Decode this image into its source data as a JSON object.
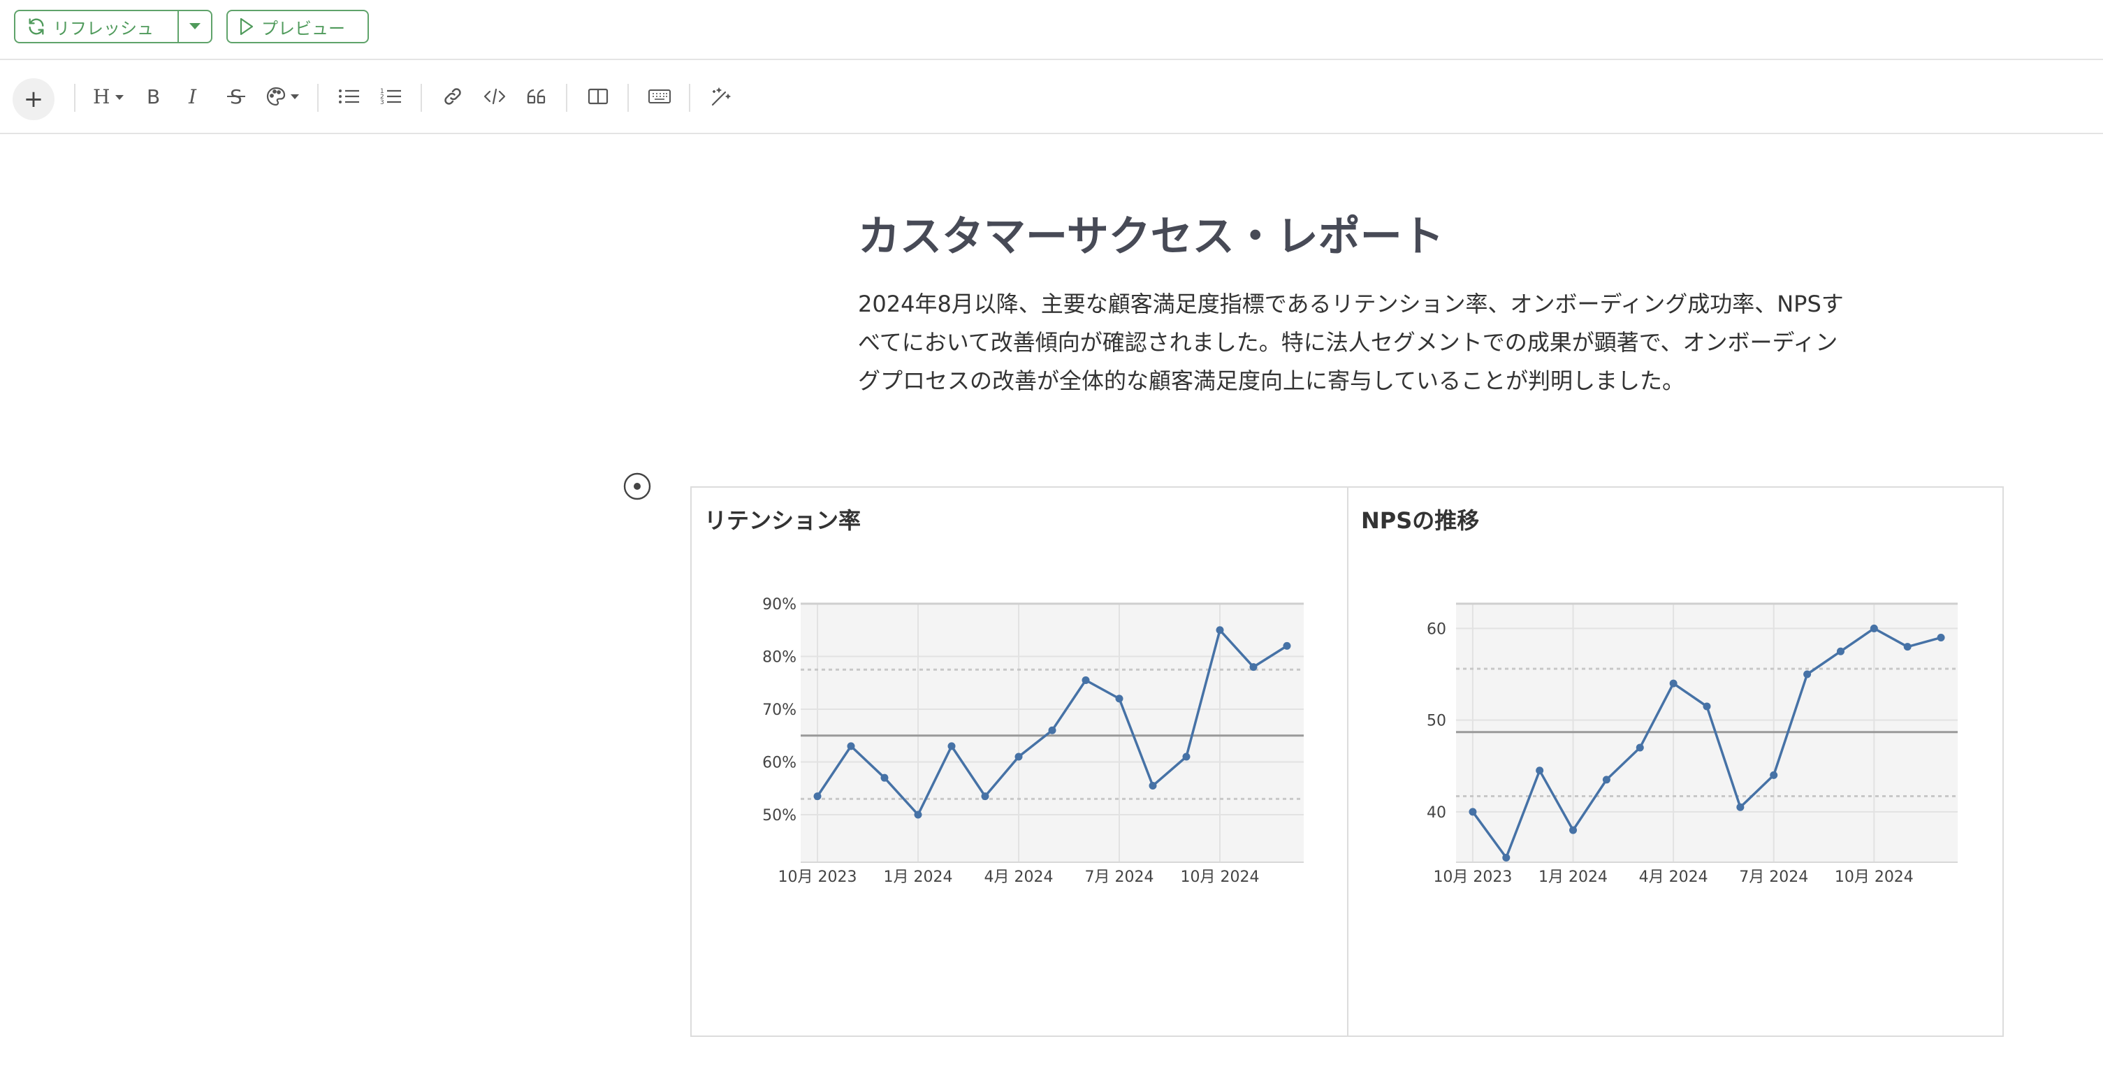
{
  "topbar": {
    "refresh_label": "リフレッシュ",
    "preview_label": "プレビュー",
    "accent_color": "#4f9a5b"
  },
  "toolbar": {
    "items": [
      "plus-icon",
      "heading-icon",
      "bold-icon",
      "italic-icon",
      "strikethrough-icon",
      "color-palette-icon",
      "bullet-list-icon",
      "numbered-list-icon",
      "link-icon",
      "code-icon",
      "quote-icon",
      "columns-icon",
      "keyboard-icon",
      "magic-wand-icon"
    ]
  },
  "document": {
    "title": "カスタマーサクセス・レポート",
    "paragraph": "2024年8月以降、主要な顧客満足度指標であるリテンション率、オンボーディング成功率、NPSすべてにおいて改善傾向が確認されました。特に法人セグメントでの成果が顕著で、オンボーディングプロセスの改善が全体的な顧客満足度向上に寄与していることが判明しました。"
  },
  "chart_data": [
    {
      "type": "line",
      "title": "リテンション率",
      "x": [
        "2023-10",
        "2023-11",
        "2023-12",
        "2024-01",
        "2024-02",
        "2024-03",
        "2024-04",
        "2024-05",
        "2024-06",
        "2024-07",
        "2024-08",
        "2024-09",
        "2024-10",
        "2024-11",
        "2024-12"
      ],
      "x_tick_labels": [
        "10月 2023",
        "1月 2024",
        "4月 2024",
        "7月 2024",
        "10月 2024"
      ],
      "y_tick_labels": [
        "50%",
        "60%",
        "70%",
        "80%",
        "90%"
      ],
      "series": [
        {
          "values": [
            53.5,
            63,
            57,
            50,
            63,
            53.5,
            61,
            66,
            75.5,
            72,
            55.5,
            61,
            85,
            78,
            82
          ]
        }
      ],
      "ylim": [
        41,
        90
      ],
      "reference_lines": {
        "mean": 65,
        "upper": 77.5,
        "lower": 53
      },
      "line_color": "#4672a6",
      "grid": true
    },
    {
      "type": "line",
      "title": "NPSの推移",
      "x": [
        "2023-10",
        "2023-11",
        "2023-12",
        "2024-01",
        "2024-02",
        "2024-03",
        "2024-04",
        "2024-05",
        "2024-06",
        "2024-07",
        "2024-08",
        "2024-09",
        "2024-10",
        "2024-11",
        "2024-12"
      ],
      "x_tick_labels": [
        "10月 2023",
        "1月 2024",
        "4月 2024",
        "7月 2024",
        "10月 2024"
      ],
      "y_tick_labels": [
        "40",
        "50",
        "60"
      ],
      "series": [
        {
          "values": [
            40,
            35,
            44.5,
            38,
            43.5,
            47,
            54,
            51.5,
            40.5,
            44,
            55,
            57.5,
            60,
            58,
            59
          ]
        }
      ],
      "ylim": [
        34.5,
        62.7
      ],
      "reference_lines": {
        "mean": 48.7,
        "upper": 55.6,
        "lower": 41.7
      },
      "line_color": "#4672a6",
      "grid": true
    }
  ]
}
